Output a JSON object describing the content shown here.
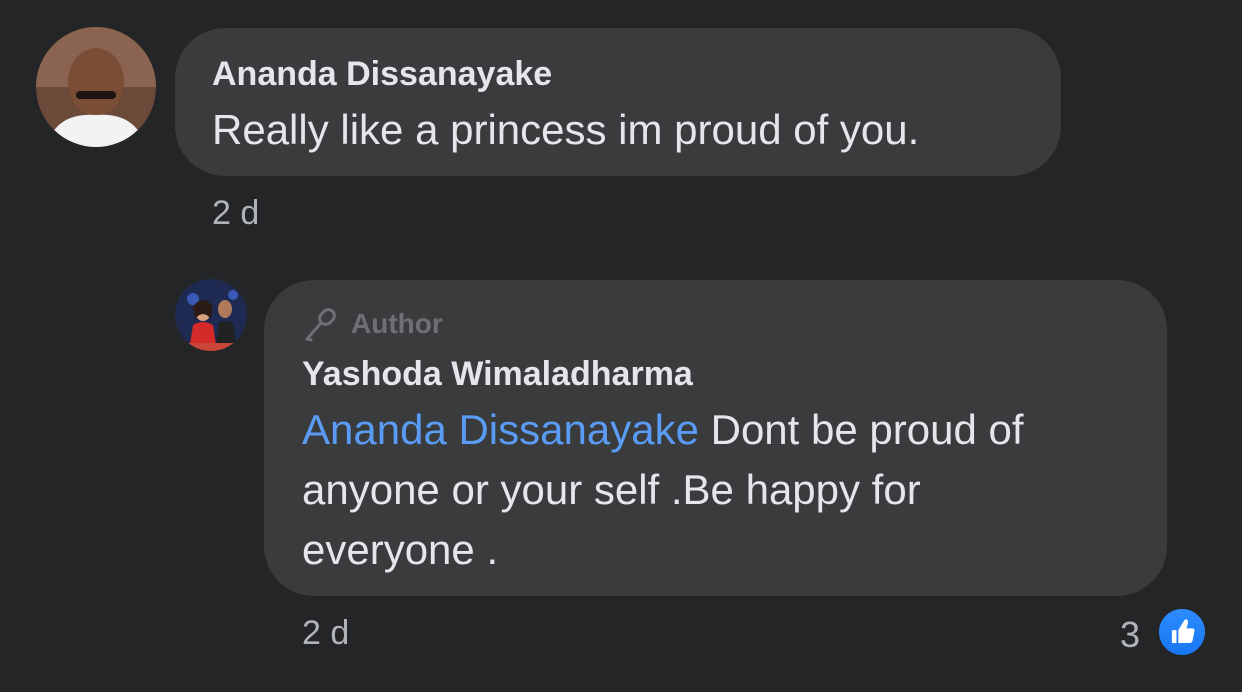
{
  "comment": {
    "author": "Ananda Dissanayake",
    "text": "Really like a princess im proud of you.",
    "time": "2 d"
  },
  "reply": {
    "badge": "Author",
    "author": "Yashoda Wimaladharma",
    "mention": "Ananda Dissanayake",
    "text_line1": " Dont be proud of",
    "text_line2": "anyone or your self .Be happy for",
    "text_line3": "everyone .",
    "time": "2 d",
    "reaction_count": "3"
  },
  "colors": {
    "background": "#242526",
    "bubble": "#3a3b3c",
    "mention": "#5a9cf5",
    "like": "#1877f2"
  }
}
